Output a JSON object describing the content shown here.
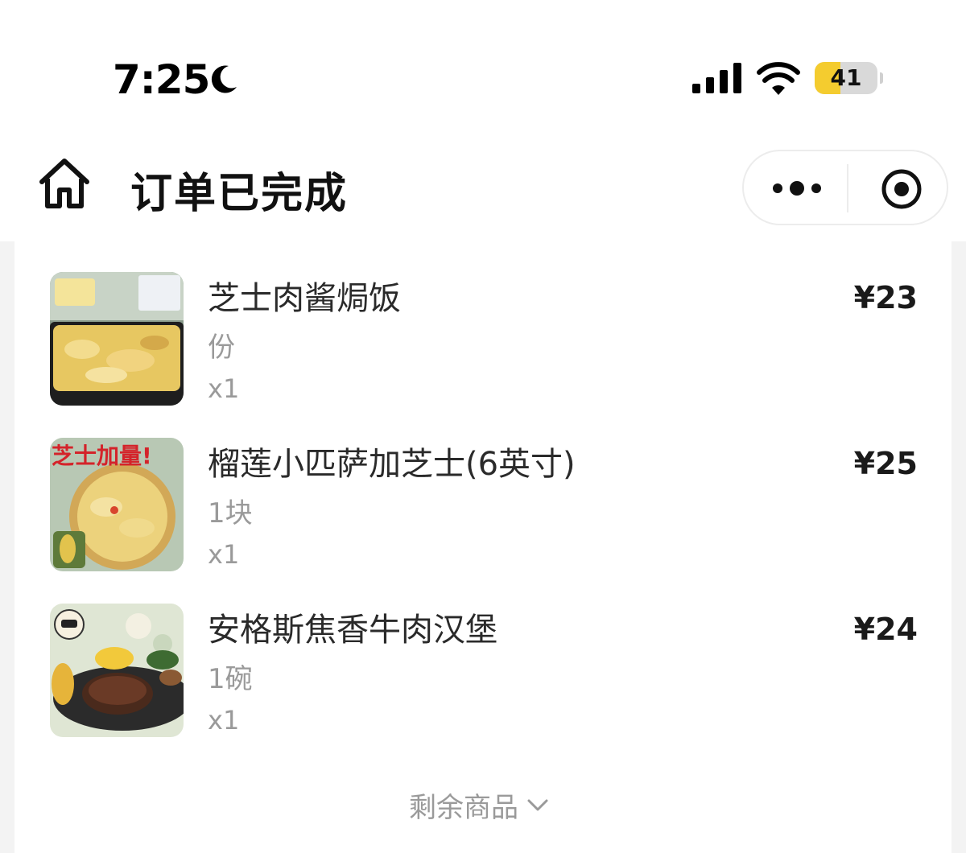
{
  "status_bar": {
    "time": "7:25",
    "battery_level": "41",
    "battery_fraction": 0.41,
    "battery_color": "#f4cc2f"
  },
  "header": {
    "title": "订单已完成",
    "home_icon": "home-icon",
    "more_icon": "more-dots-icon",
    "close_icon": "target-close-icon"
  },
  "items": [
    {
      "name": "芝士肉酱焗饭",
      "spec": "份",
      "qty": "x1",
      "price": "¥23",
      "thumb_icon": "cheese-baked-rice-image"
    },
    {
      "name": "榴莲小匹萨加芝士(6英寸)",
      "spec": "1块",
      "qty": "x1",
      "price": "¥25",
      "thumb_icon": "durian-pizza-image",
      "thumb_caption": "芝士加量!"
    },
    {
      "name": "安格斯焦香牛肉汉堡",
      "spec": "1碗",
      "qty": "x1",
      "price": "¥24",
      "thumb_icon": "angus-beef-steak-image"
    }
  ],
  "remaining_label": "剩余商品"
}
